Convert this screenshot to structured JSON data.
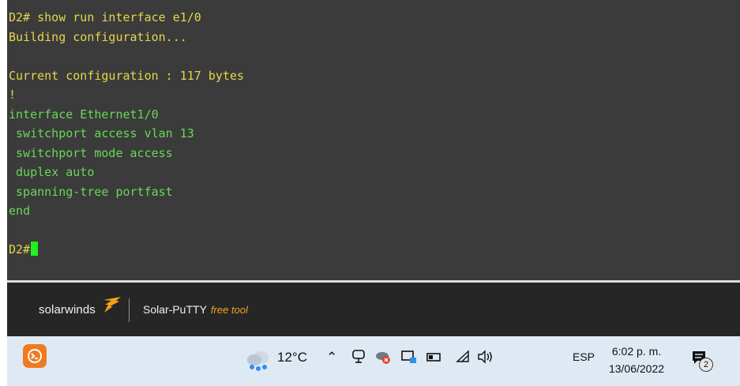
{
  "terminal": {
    "lines": [
      {
        "text": "D2# show run interface e1/0",
        "color": "#e5d64a"
      },
      {
        "text": "Building configuration...",
        "color": "#e5d64a"
      },
      {
        "text": "",
        "color": "#e6e6e6"
      },
      {
        "text": "Current configuration : 117 bytes",
        "color": "#e5d64a"
      },
      {
        "text": "!",
        "color": "#e5d64a"
      },
      {
        "text": "interface Ethernet1/0",
        "color": "#66d955"
      },
      {
        "text": " switchport access vlan 13",
        "color": "#66d955"
      },
      {
        "text": " switchport mode access",
        "color": "#66d955"
      },
      {
        "text": " duplex auto",
        "color": "#66d955"
      },
      {
        "text": " spanning-tree portfast",
        "color": "#66d955"
      },
      {
        "text": "end",
        "color": "#66d955"
      },
      {
        "text": "",
        "color": "#e6e6e6"
      }
    ],
    "prompt": "D2#",
    "colors": {
      "background": "#3b3b3b",
      "cursor": "#22ee22"
    }
  },
  "brand": {
    "logo_text": "solarwinds",
    "product": "Solar-PuTTY",
    "tag": "free tool",
    "colors": {
      "bar": "#262626",
      "tag": "#f5a11a"
    }
  },
  "taskbar": {
    "app_icon": "solar-putty-app-icon",
    "weather": {
      "temp": "12°C",
      "icon": "cloud-rain-icon"
    },
    "chevron": "^",
    "tray_icons": [
      "meet-now-icon",
      "cloud-sync-icon",
      "network-icon",
      "battery-icon",
      "wifi-icon",
      "volume-icon"
    ],
    "language": "ESP",
    "time": "6:02 p. m.",
    "date": "13/06/2022",
    "notifications": {
      "icon": "notification-icon",
      "count": "2"
    },
    "colors": {
      "background": "#dfe9f3"
    }
  }
}
